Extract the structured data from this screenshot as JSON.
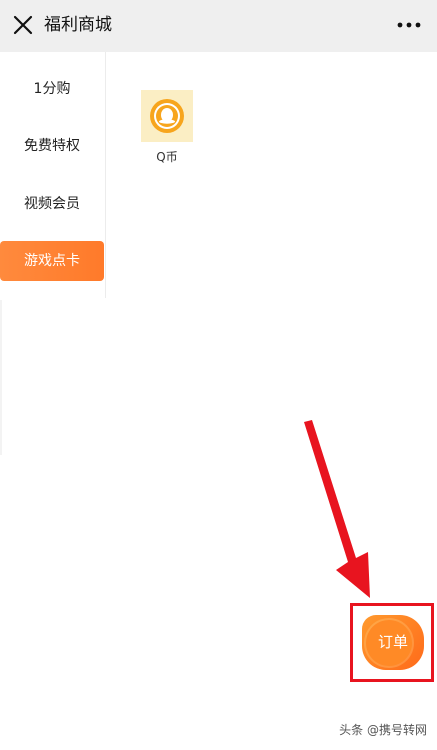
{
  "header": {
    "title": "福利商城",
    "close_icon": "close-icon",
    "more_icon": "more-dots-icon"
  },
  "sidebar": {
    "items": [
      {
        "label": "1分购",
        "active": false
      },
      {
        "label": "免费特权",
        "active": false
      },
      {
        "label": "视频会员",
        "active": false
      },
      {
        "label": "游戏点卡",
        "active": true
      }
    ]
  },
  "products": [
    {
      "name": "Q币",
      "icon": "qq-coin-icon"
    }
  ],
  "order_button": {
    "label": "订单"
  },
  "watermark": "头条 @携号转网",
  "colors": {
    "accent": "#ff7a2a",
    "highlight": "#e8141f"
  }
}
